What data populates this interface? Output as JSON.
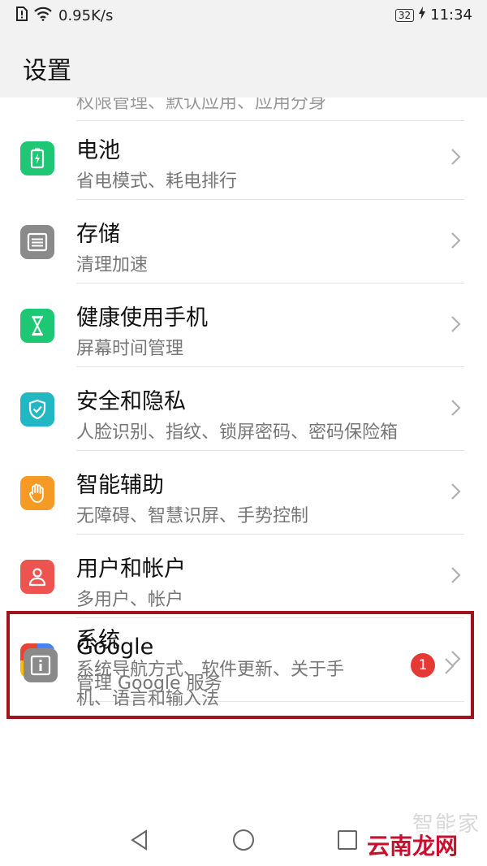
{
  "status_bar": {
    "speed": "0.95K/s",
    "battery": "32",
    "time": "11:34"
  },
  "header": {
    "title": "设置"
  },
  "cut_off_item": {
    "subtitle": "权限管理、默认应用、应用分身"
  },
  "items": [
    {
      "title": "电池",
      "subtitle": "省电模式、耗电排行",
      "icon": "battery-icon",
      "color": "#1ec774"
    },
    {
      "title": "存储",
      "subtitle": "清理加速",
      "icon": "storage-icon",
      "color": "#8a8a8a"
    },
    {
      "title": "健康使用手机",
      "subtitle": "屏幕时间管理",
      "icon": "hourglass-icon",
      "color": "#1ec774"
    },
    {
      "title": "安全和隐私",
      "subtitle": "人脸识别、指纹、锁屏密码、密码保险箱",
      "icon": "shield-icon",
      "color": "#21b8c4"
    },
    {
      "title": "智能辅助",
      "subtitle": "无障碍、智慧识屏、手势控制",
      "icon": "hand-icon",
      "color": "#f59a23"
    },
    {
      "title": "用户和帐户",
      "subtitle": "多用户、帐户",
      "icon": "user-icon",
      "color": "#ef5350"
    },
    {
      "title": "Google",
      "subtitle": "管理 Google 服务",
      "icon": "google-icon",
      "color": "#4285f4"
    }
  ],
  "system_item": {
    "title": "系统",
    "subtitle_line1": "系统导航方式、软件更新、关于手",
    "subtitle_line2": "机、语言和输入法",
    "badge": "1",
    "icon": "system-info-icon",
    "color": "#8a8a8a",
    "highlight_color": "#a0151c"
  },
  "watermark": {
    "line1": "智能家",
    "line2": "云南龙网"
  }
}
